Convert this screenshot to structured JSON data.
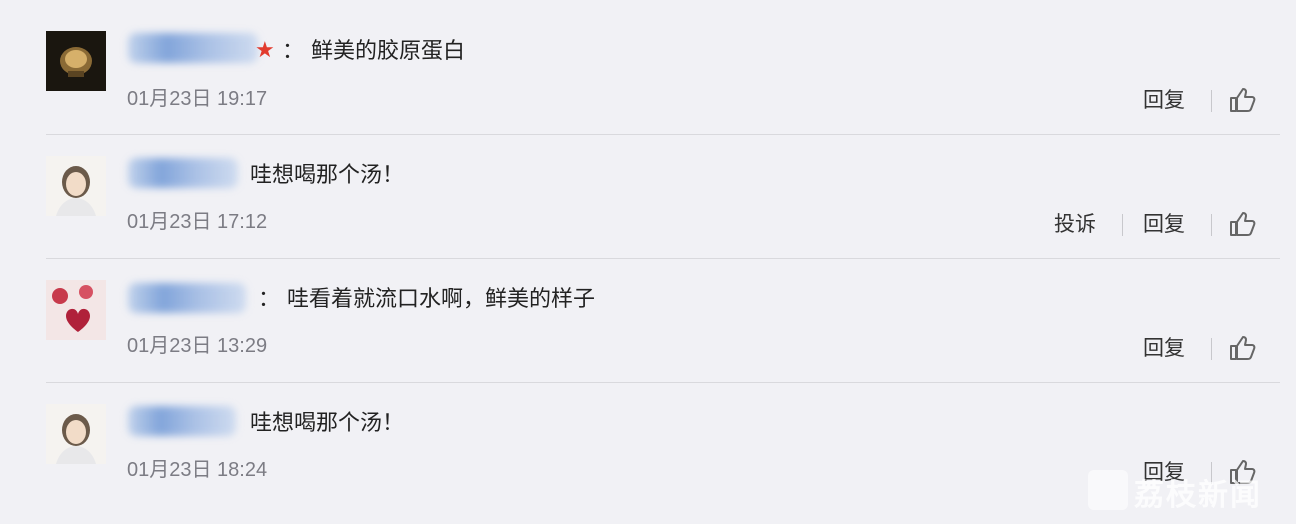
{
  "comments": [
    {
      "text": "： 鲜美的胶原蛋白",
      "time": "01月23日 19:17",
      "reply": "回复"
    },
    {
      "text": "哇想喝那个汤！",
      "time": "01月23日 17:12",
      "report": "投诉",
      "reply": "回复"
    },
    {
      "text": "： 哇看着就流口水啊，鲜美的样子",
      "time": "01月23日 13:29",
      "reply": "回复"
    },
    {
      "text": "哇想喝那个汤！",
      "time": "01月23日 18:24",
      "reply": "回复"
    }
  ],
  "watermark": {
    "text": "荔枝新闻"
  },
  "icons": {
    "like": "thumbs-up-icon",
    "star": "star-icon"
  }
}
